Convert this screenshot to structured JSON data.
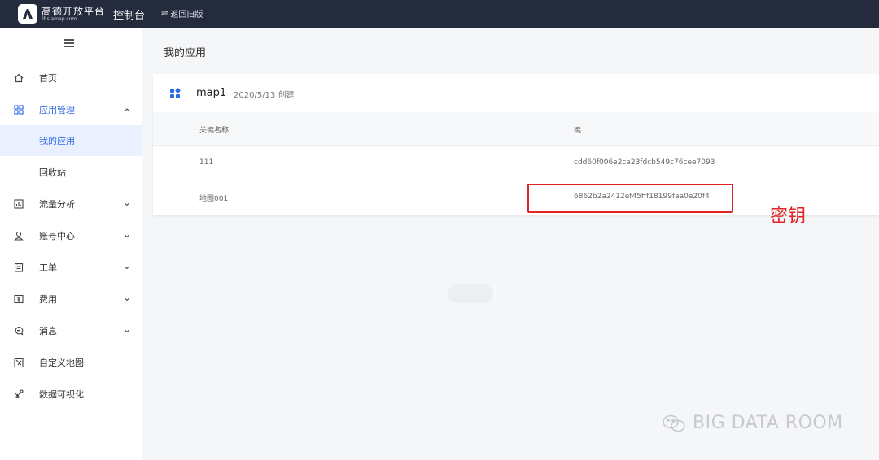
{
  "topbar": {
    "logo_name": "高德开放平台",
    "logo_url": "lbs.amap.com",
    "console": "控制台",
    "back_old": "返回旧版"
  },
  "sidebar": {
    "items": [
      {
        "label": "首页",
        "icon": "home-icon"
      },
      {
        "label": "应用管理",
        "icon": "grid-icon",
        "expanded": true
      },
      {
        "label": "我的应用",
        "selected": true
      },
      {
        "label": "回收站"
      },
      {
        "label": "流量分析",
        "icon": "chart-icon"
      },
      {
        "label": "账号中心",
        "icon": "user-icon"
      },
      {
        "label": "工单",
        "icon": "ticket-icon"
      },
      {
        "label": "费用",
        "icon": "money-icon"
      },
      {
        "label": "消息",
        "icon": "message-icon"
      },
      {
        "label": "自定义地图",
        "icon": "map-icon"
      },
      {
        "label": "数据可视化",
        "icon": "visual-icon"
      }
    ]
  },
  "main": {
    "page_title": "我的应用",
    "app": {
      "name": "map1",
      "created": "2020/5/13 创建"
    },
    "table": {
      "columns": [
        "关键名称",
        "键"
      ],
      "rows": [
        {
          "name": "111",
          "key": "cdd60f006e2ca23fdcb549c76cee7093"
        },
        {
          "name": "地图001",
          "key": "6862b2a2412ef45fff18199faa0e20f4"
        }
      ]
    },
    "annotation": "密钥"
  },
  "watermark": "BIG DATA ROOM",
  "colors": {
    "accent": "#2e6ae6",
    "topbar": "#242b3d",
    "highlight": "#e02424"
  }
}
